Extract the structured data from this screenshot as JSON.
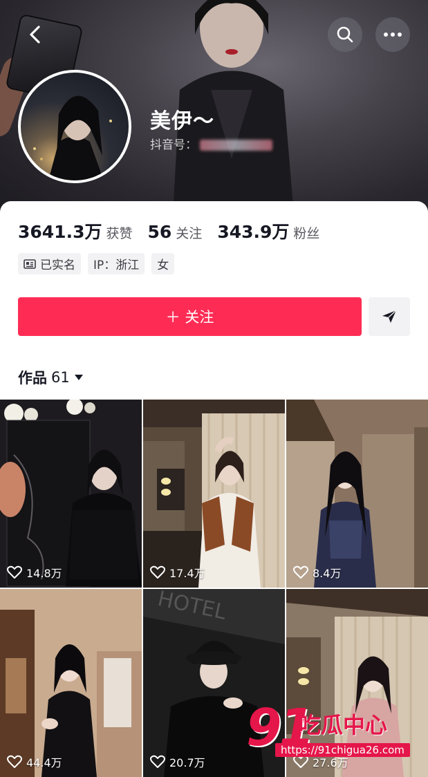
{
  "profile": {
    "name": "美伊～",
    "douyin_id_label": "抖音号：",
    "stats": [
      {
        "value": "3641.3万",
        "label": "获赞"
      },
      {
        "value": "56",
        "label": "关注"
      },
      {
        "value": "343.9万",
        "label": "粉丝"
      }
    ],
    "tags": [
      "已实名",
      "IP：浙江",
      "女"
    ]
  },
  "actions": {
    "follow_label": "＋ 关注"
  },
  "works": {
    "tab_label": "作品",
    "count": "61"
  },
  "videos": [
    {
      "likes": "14.8万"
    },
    {
      "likes": "17.4万"
    },
    {
      "likes": "8.4万"
    },
    {
      "likes": "44.4万"
    },
    {
      "likes": "20.7万"
    },
    {
      "likes": "27.6万"
    }
  ],
  "watermark": {
    "number": "91",
    "text": "吃瓜中心",
    "url": "https://91chigua26.com"
  },
  "colors": {
    "accent": "#fe2c55",
    "watermark": "#e5164a"
  }
}
